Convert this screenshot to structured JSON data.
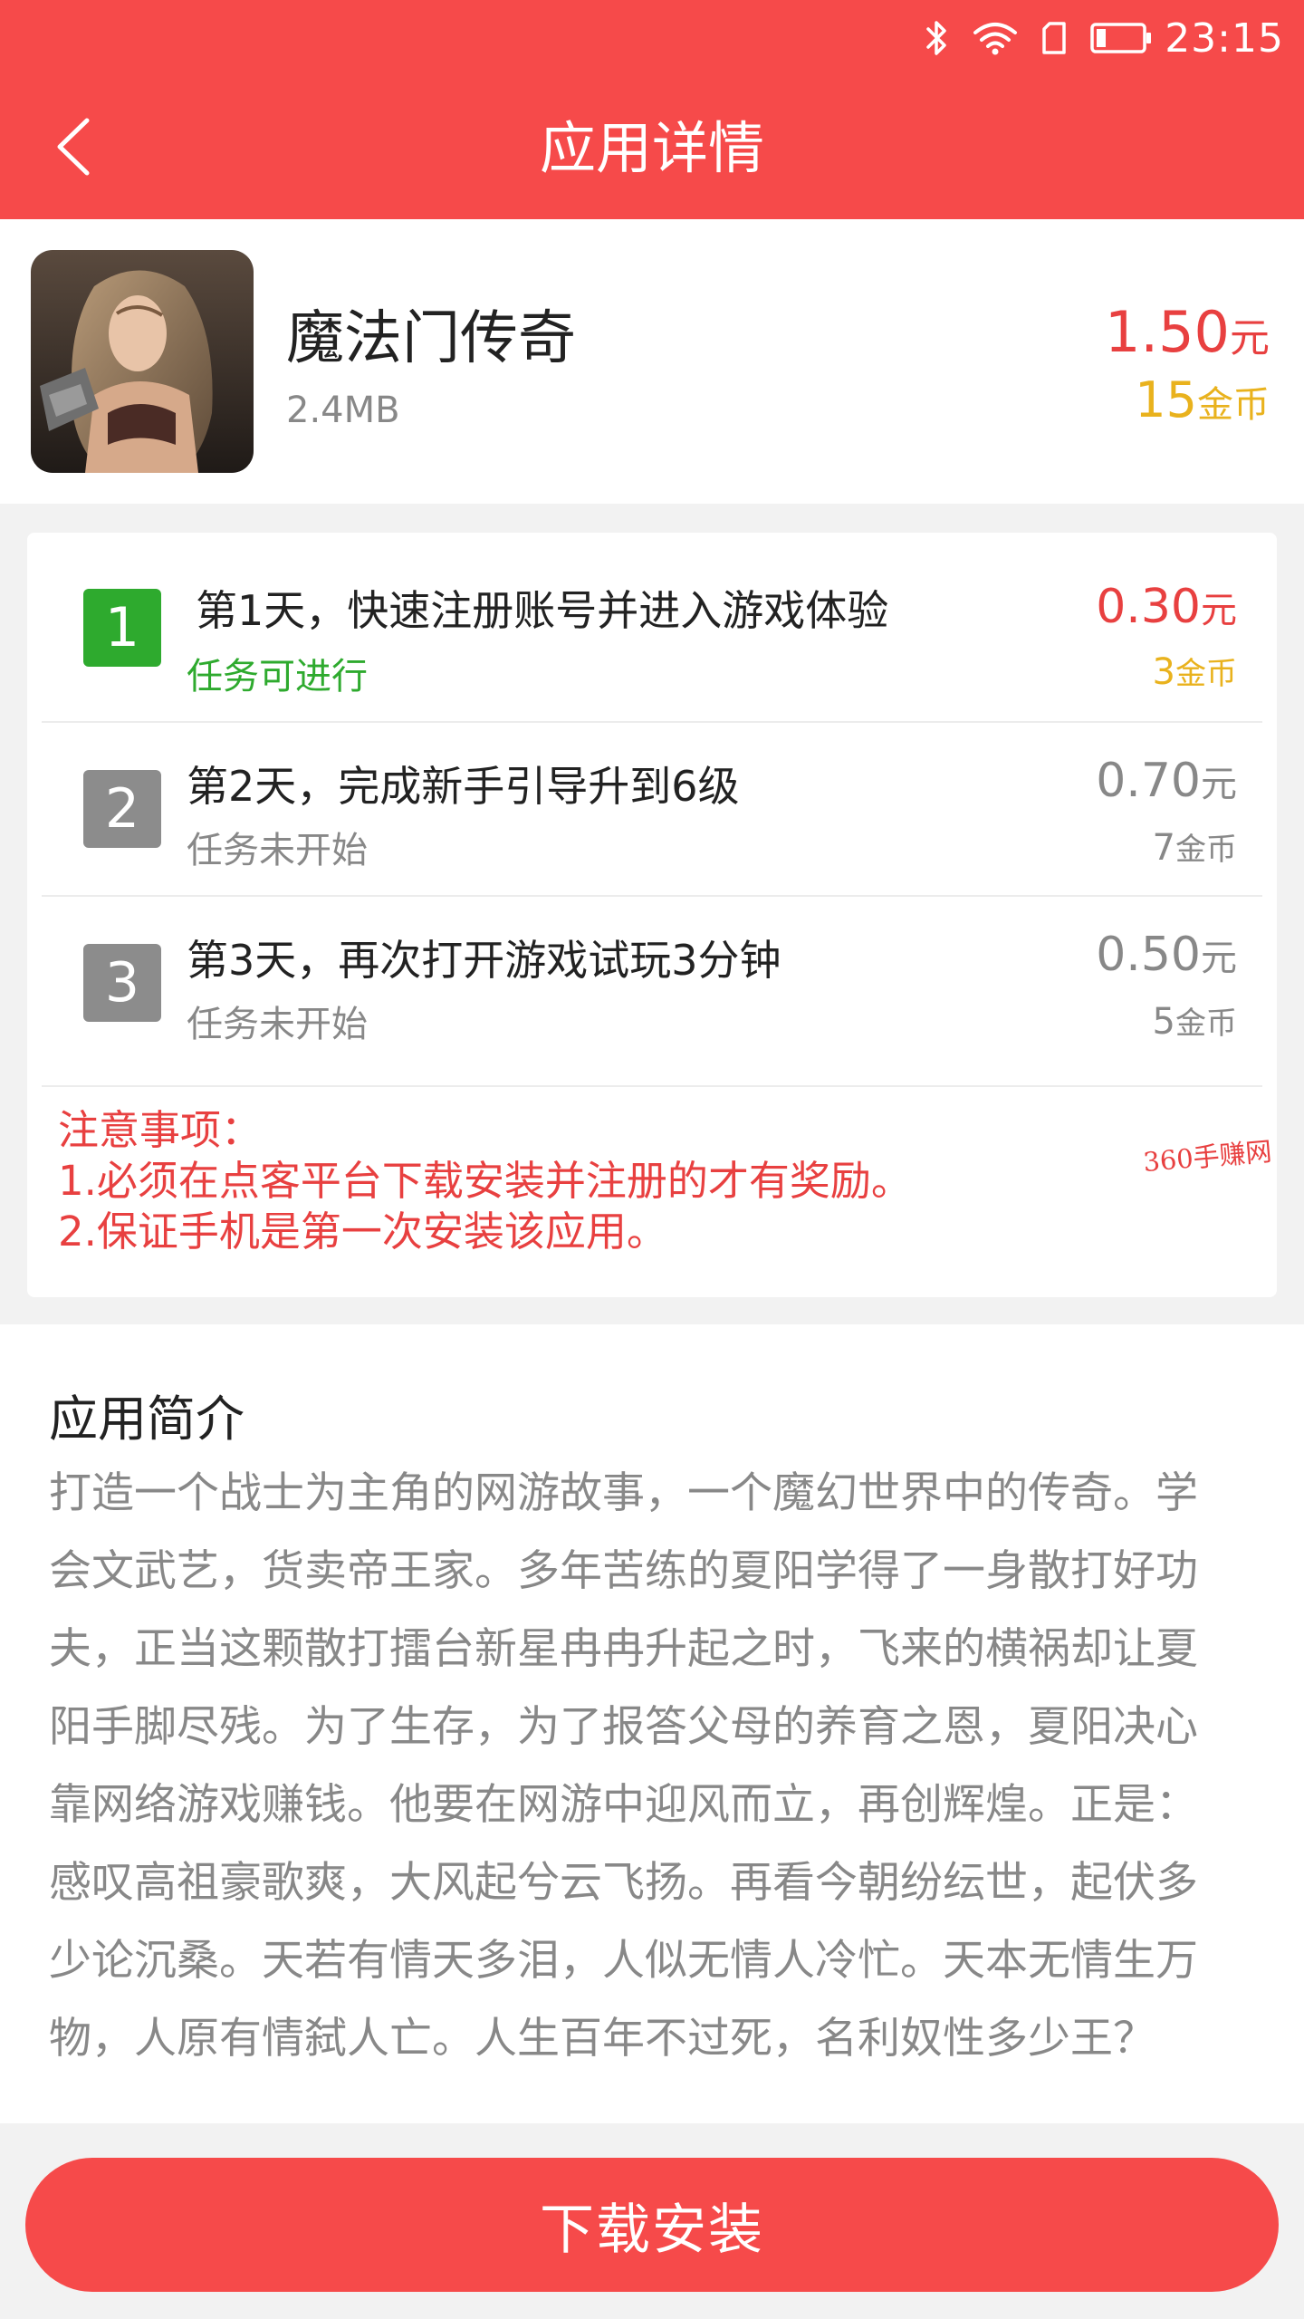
{
  "status_bar": {
    "time": "23:15",
    "icons": [
      "bluetooth-icon",
      "wifi-icon",
      "sim-icon",
      "battery-icon"
    ]
  },
  "nav": {
    "title": "应用详情"
  },
  "app": {
    "name": "魔法门传奇",
    "size": "2.4MB",
    "price": "1.50",
    "price_unit": "元",
    "coins": "15",
    "coins_unit": "金币"
  },
  "tasks": [
    {
      "index": "1",
      "title": "第1天，快速注册账号并进入游戏体验",
      "status": "任务可进行",
      "price": "0.30",
      "price_unit": "元",
      "coins": "3",
      "coins_unit": "金币"
    },
    {
      "index": "2",
      "title": "第2天，完成新手引导升到6级",
      "status": "任务未开始",
      "price": "0.70",
      "price_unit": "元",
      "coins": "7",
      "coins_unit": "金币"
    },
    {
      "index": "3",
      "title": "第3天，再次打开游戏试玩3分钟",
      "status": "任务未开始",
      "price": "0.50",
      "price_unit": "元",
      "coins": "5",
      "coins_unit": "金币"
    }
  ],
  "notes": {
    "heading": "注意事项：",
    "lines": [
      "1.必须在点客平台下载安装并注册的才有奖励。",
      "2.保证手机是第一次安装该应用。"
    ]
  },
  "watermark": "360手赚网",
  "intro": {
    "title": "应用简介",
    "lines": [
      "打造一个战士为主角的网游故事，一个魔幻世界中的传奇。学",
      "会文武艺，货卖帝王家。多年苦练的夏阳学得了一身散打好功",
      "夫，正当这颗散打擂台新星冉冉升起之时，飞来的横祸却让夏",
      "阳手脚尽残。为了生存，为了报答父母的养育之恩，夏阳决心",
      "靠网络游戏赚钱。他要在网游中迎风而立，再创辉煌。正是：",
      "感叹高祖豪歌爽，大风起兮云飞扬。再看今朝纷纭世，起伏多",
      "少论沉桑。天若有情天多泪，人似无情人冷忙。天本无情生万",
      "物，人原有情弑人亡。人生百年不过死，名利奴性多少王？"
    ]
  },
  "download_button": {
    "label": "下载安装"
  },
  "colors": {
    "brand_red": "#f64a4a",
    "price_red": "#e84040",
    "coin_gold": "#e9b21d",
    "active_green": "#2eaa2e",
    "idle_gray": "#8c8c8c"
  }
}
